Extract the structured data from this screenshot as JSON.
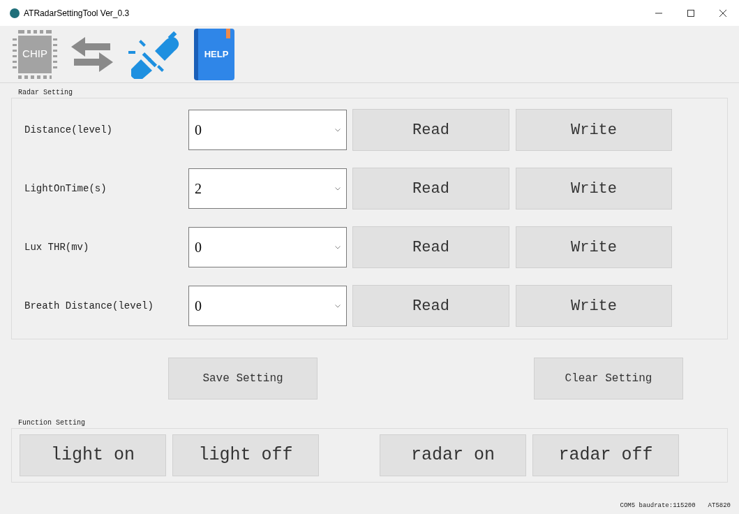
{
  "window": {
    "title": "ATRadarSettingTool Ver_0.3"
  },
  "toolbar": [
    {
      "kind": "chip",
      "text": "CHIP"
    },
    {
      "kind": "swap"
    },
    {
      "kind": "plug"
    },
    {
      "kind": "help",
      "text": "HELP"
    }
  ],
  "radar_setting": {
    "title": "Radar Setting",
    "rows": [
      {
        "label": "Distance(level)",
        "value": "0",
        "read": "Read",
        "write": "Write"
      },
      {
        "label": "LightOnTime(s)",
        "value": "2",
        "read": "Read",
        "write": "Write"
      },
      {
        "label": "Lux THR(mv)",
        "value": "0",
        "read": "Read",
        "write": "Write"
      },
      {
        "label": "Breath Distance(level)",
        "value": "0",
        "read": "Read",
        "write": "Write"
      }
    ]
  },
  "actions": [
    "Save Setting",
    "Clear Setting"
  ],
  "function_setting": {
    "title": "Function Setting",
    "buttons": [
      "light on",
      "light off",
      "radar on",
      "radar off"
    ]
  },
  "status_bar": [
    "COM5 baudrate:115200",
    "AT5820"
  ]
}
